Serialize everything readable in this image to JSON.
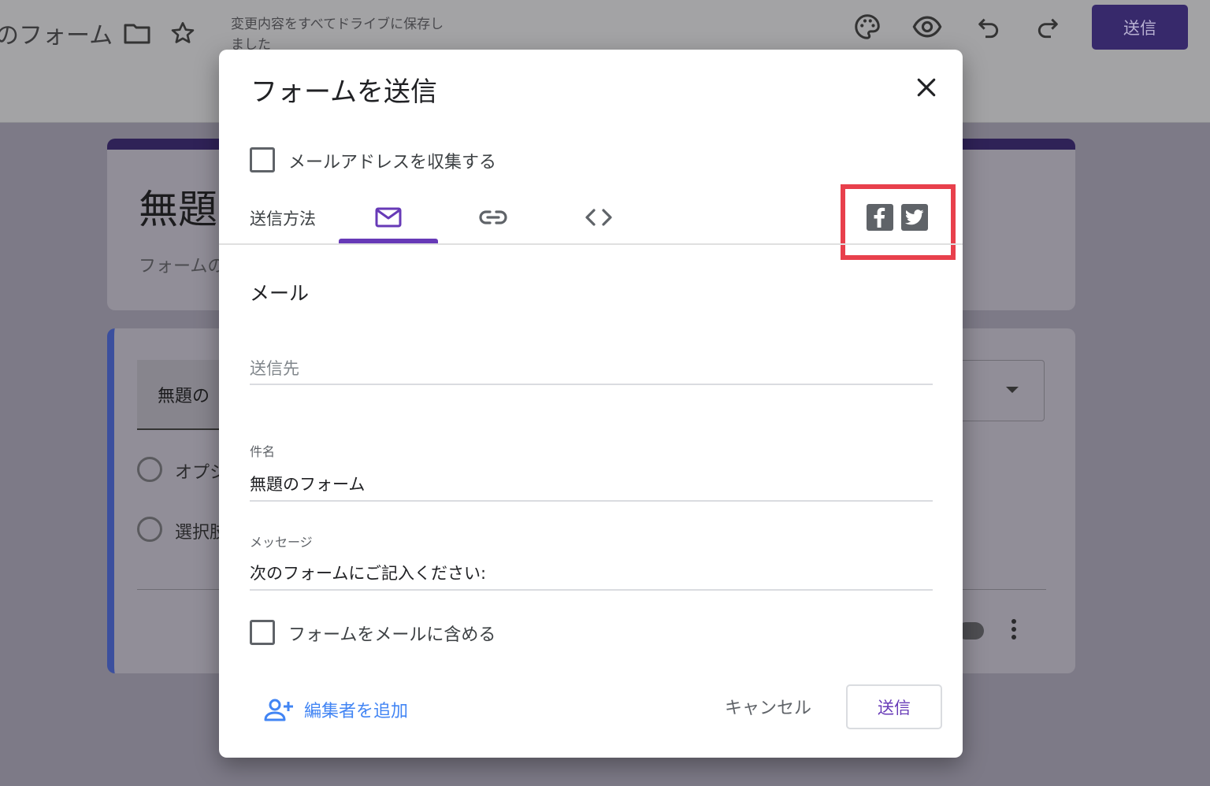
{
  "header": {
    "form_title": "のフォーム",
    "save_status": "変更内容をすべてドライブに保存しました",
    "send_label": "送信",
    "icons": [
      "folder-icon",
      "star-icon",
      "palette-icon",
      "eye-icon",
      "undo-icon",
      "redo-icon"
    ]
  },
  "background": {
    "title": "無題",
    "description": "フォームの",
    "question_title": "無題の",
    "option_1": "オプシ",
    "option_2": "選択肢"
  },
  "dialog": {
    "title": "フォームを送信",
    "collect_email_label": "メールアドレスを収集する",
    "send_via_label": "送信方法",
    "tabs": [
      "email-icon",
      "link-icon",
      "embed-icon"
    ],
    "social": [
      "facebook-icon",
      "twitter-icon"
    ],
    "email_section_title": "メール",
    "to_placeholder": "送信先",
    "subject_label": "件名",
    "subject_value": "無題のフォーム",
    "message_label": "メッセージ",
    "message_value": "次のフォームにご記入ください:",
    "include_form_label": "フォームをメールに含める",
    "add_editor_label": "編集者を追加",
    "cancel_label": "キャンセル",
    "send_label": "送信"
  },
  "colors": {
    "accent": "#673ab7",
    "link": "#4285f4",
    "highlight": "#e8404c"
  }
}
